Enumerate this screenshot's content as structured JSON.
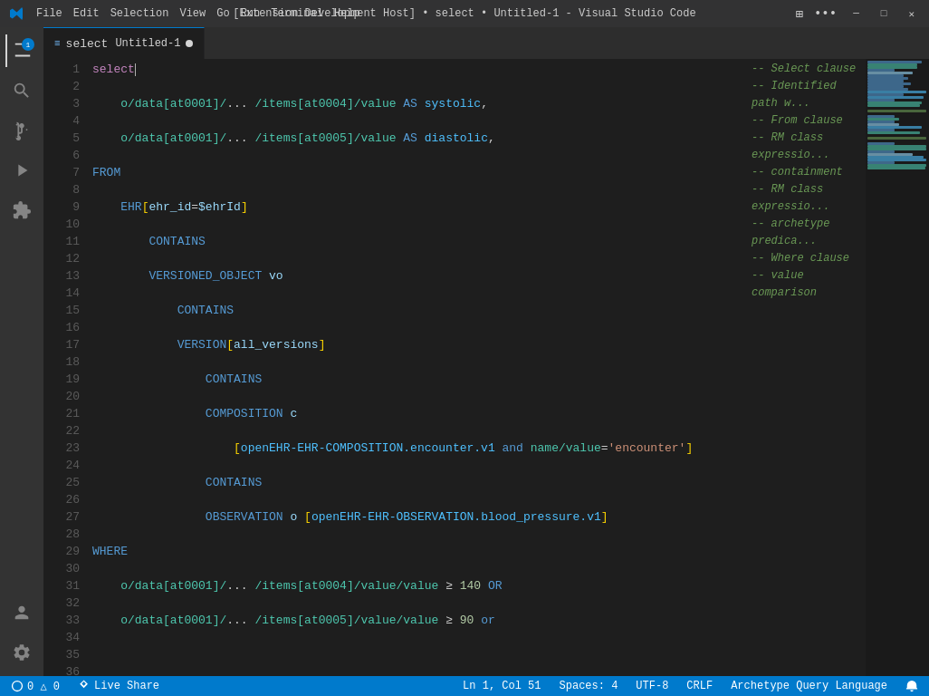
{
  "titlebar": {
    "title": "[Extension Development Host] • select • Untitled-1 - Visual Studio Code",
    "menu_items": [
      "File",
      "Edit",
      "Selection",
      "View",
      "Go",
      "Run",
      "Terminal",
      "Help"
    ],
    "controls": [
      "─",
      "□",
      "✕"
    ]
  },
  "tabs": [
    {
      "label": "select",
      "filename": "Untitled-1",
      "modified": true,
      "active": true
    }
  ],
  "statusbar": {
    "left": [
      {
        "icon": "source-control-icon",
        "text": "0 △ 0"
      },
      {
        "icon": "live-share-icon",
        "text": "Live Share"
      }
    ],
    "right": [
      {
        "text": "Ln 1, Col 51"
      },
      {
        "text": "Spaces: 4"
      },
      {
        "text": "UTF-8"
      },
      {
        "text": "CRLF"
      },
      {
        "text": "Archetype Query Language"
      },
      {
        "icon": "bell-icon",
        "text": ""
      }
    ]
  },
  "language": "Archetype Query Language"
}
